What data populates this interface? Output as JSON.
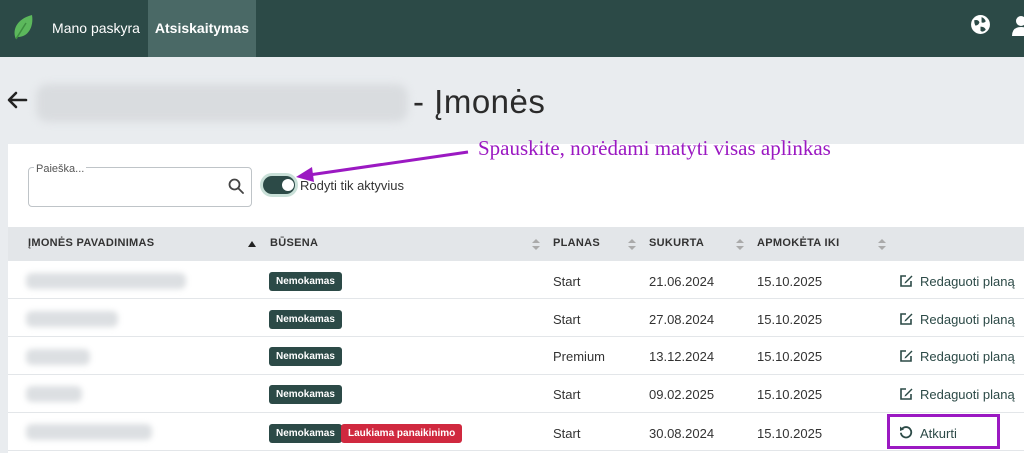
{
  "nav": {
    "account_label": "Mano paskyra",
    "billing_label": "Atsiskaitymas"
  },
  "page": {
    "title": "- Įmonės"
  },
  "filters": {
    "search_label": "Paieška...",
    "active_toggle_label": "Rodyti tik aktyvius",
    "active_only": true
  },
  "annotation": {
    "text": "Spauskite, norėdami matyti visas aplinkas",
    "color": "#9b19c2"
  },
  "table": {
    "headers": {
      "name": "ĮMONĖS PAVADINIMAS",
      "status": "BŪSENA",
      "plan": "PLANAS",
      "created": "SUKURTA",
      "paid_until": "APMOKĖTA IKI"
    },
    "rows": [
      {
        "badge": "Nemokamas",
        "plan": "Start",
        "created": "21.06.2024",
        "paid_until": "15.10.2025",
        "action": "Redaguoti planą"
      },
      {
        "badge": "Nemokamas",
        "plan": "Start",
        "created": "27.08.2024",
        "paid_until": "15.10.2025",
        "action": "Redaguoti planą"
      },
      {
        "badge": "Nemokamas",
        "plan": "Premium",
        "created": "13.12.2024",
        "paid_until": "15.10.2025",
        "action": "Redaguoti planą"
      },
      {
        "badge": "Nemokamas",
        "plan": "Start",
        "created": "09.02.2025",
        "paid_until": "15.10.2025",
        "action": "Redaguoti planą"
      },
      {
        "badge": "Nemokamas",
        "badge2": "Laukiama panaikinimo",
        "plan": "Start",
        "created": "30.08.2024",
        "paid_until": "15.10.2025",
        "action": "Atkurti"
      }
    ]
  },
  "colors": {
    "topbar": "#2c4a47",
    "accent": "#2c4a47",
    "danger": "#d0293f",
    "annotation": "#9b19c2"
  },
  "icons": [
    "leaf-logo-icon",
    "globe-icon",
    "user-icon",
    "back-arrow-icon",
    "search-icon",
    "sort-icon",
    "edit-icon",
    "restore-icon"
  ]
}
